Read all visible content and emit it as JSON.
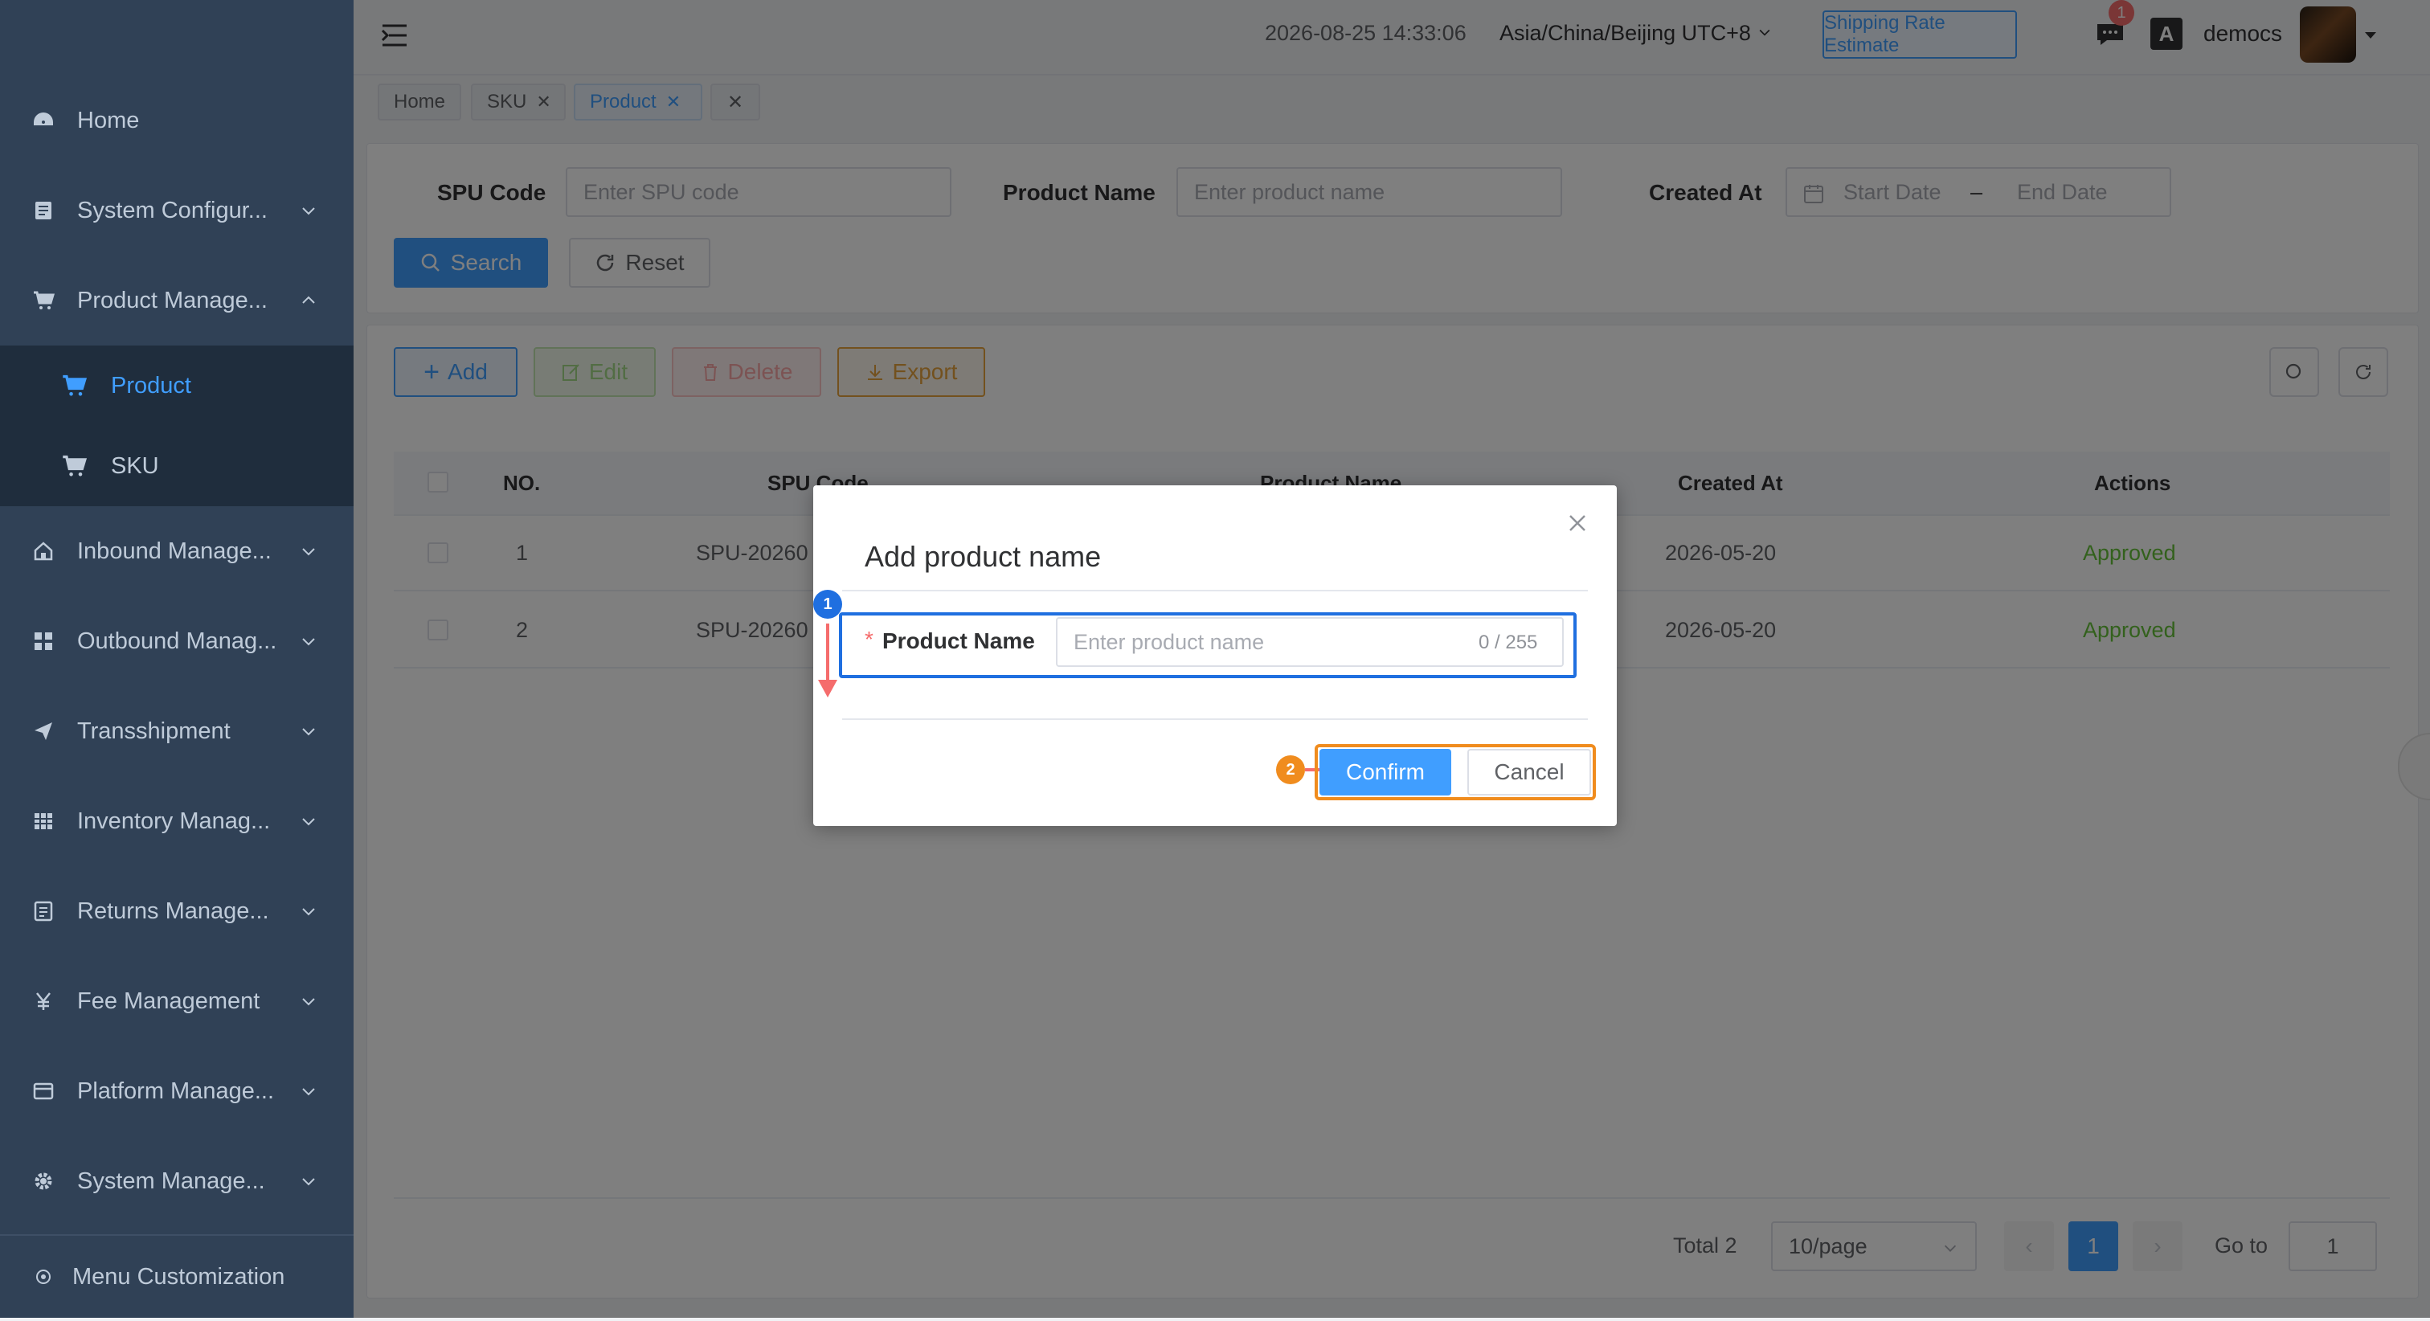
{
  "sidebar": {
    "items": [
      {
        "label": "Home",
        "icon": "dashboard-icon"
      },
      {
        "label": "System Configur...",
        "icon": "config-icon"
      },
      {
        "label": "Product Manage...",
        "icon": "cart-icon"
      },
      {
        "label": "Inbound Manage...",
        "icon": "home-icon"
      },
      {
        "label": "Outbound Manag...",
        "icon": "grid-icon"
      },
      {
        "label": "Transshipment",
        "icon": "send-icon"
      },
      {
        "label": "Inventory Manag...",
        "icon": "table-icon"
      },
      {
        "label": "Returns Manage...",
        "icon": "returns-icon"
      },
      {
        "label": "Fee Management",
        "icon": "yen-icon"
      },
      {
        "label": "Platform Manage...",
        "icon": "platform-icon"
      },
      {
        "label": "System Manage...",
        "icon": "gear-icon"
      }
    ],
    "sub_items": [
      {
        "label": "Product",
        "active": true
      },
      {
        "label": "SKU",
        "active": false
      }
    ],
    "footer": "Menu Customization"
  },
  "header": {
    "datetime": "2026-08-25 14:33:06",
    "timezone": "Asia/China/Beijing UTC+8",
    "rate_button": "Shipping Rate Estimate",
    "notification_count": "1",
    "username": "democs"
  },
  "tabs": [
    {
      "label": "Home"
    },
    {
      "label": "SKU"
    },
    {
      "label": "Product"
    }
  ],
  "filters": {
    "spu_label": "SPU Code",
    "spu_placeholder": "Enter SPU code",
    "name_label": "Product Name",
    "name_placeholder": "Enter product name",
    "created_label": "Created At",
    "start_placeholder": "Start Date",
    "date_sep": "–",
    "end_placeholder": "End Date",
    "search_btn": "Search",
    "reset_btn": "Reset"
  },
  "toolbar": {
    "add": "Add",
    "edit": "Edit",
    "delete": "Delete",
    "export": "Export"
  },
  "table": {
    "headers": [
      "NO.",
      "SPU Code",
      "Product Name",
      "Created At",
      "Actions"
    ],
    "rows": [
      {
        "no": "1",
        "spu": "SPU-20260",
        "created": "2026-05-20",
        "action": "Approved"
      },
      {
        "no": "2",
        "spu": "SPU-20260",
        "created": "2026-05-20",
        "action": "Approved"
      }
    ]
  },
  "pagination": {
    "total": "Total 2",
    "page_size": "10/page",
    "current": "1",
    "goto_label": "Go to",
    "goto_value": "1"
  },
  "dialog": {
    "title": "Add product name",
    "field_label": "Product Name",
    "required_mark": "*",
    "placeholder": "Enter product name",
    "counter": "0 / 255",
    "confirm": "Confirm",
    "cancel": "Cancel",
    "step1": "1",
    "step2": "2"
  },
  "colors": {
    "primary": "#409eff",
    "sidebar_bg": "#304156",
    "success": "#67c23a",
    "warning": "#e6a23c",
    "annotation_orange": "#f08c1e",
    "annotation_red": "#f56c6c"
  }
}
